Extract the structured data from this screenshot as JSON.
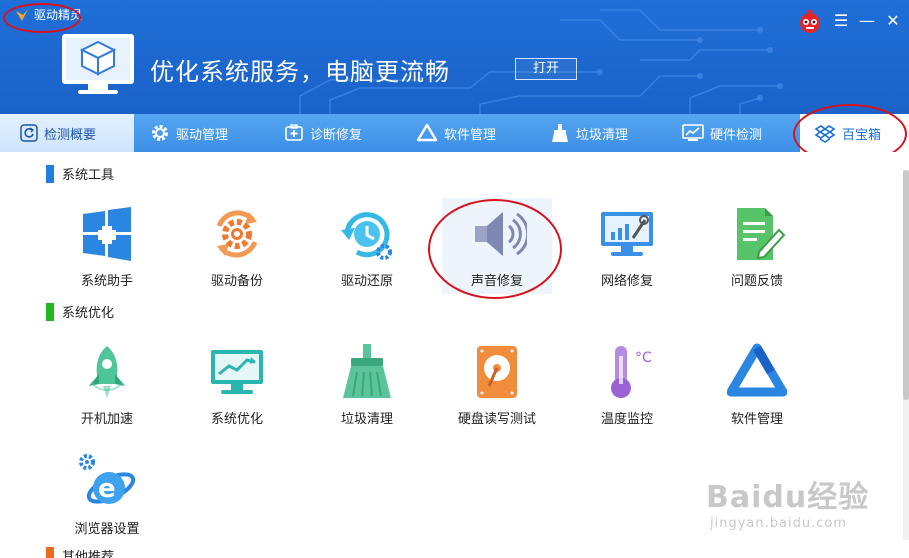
{
  "app": {
    "title": "驱动精灵"
  },
  "banner": {
    "slogan": "优化系统服务，电脑更流畅",
    "open_label": "打开"
  },
  "window": {
    "menu_glyph": "☰",
    "minimize_glyph": "—",
    "close_glyph": "✕"
  },
  "tabs": [
    {
      "label": "检测概要",
      "icon": "refresh-icon"
    },
    {
      "label": "驱动管理",
      "icon": "gear-icon"
    },
    {
      "label": "诊断修复",
      "icon": "medkit-icon"
    },
    {
      "label": "软件管理",
      "icon": "triangle-logo-icon"
    },
    {
      "label": "垃圾清理",
      "icon": "broom-icon"
    },
    {
      "label": "硬件检测",
      "icon": "chart-icon"
    },
    {
      "label": "百宝箱",
      "icon": "dropbox-icon"
    }
  ],
  "sections": [
    {
      "title": "系统工具",
      "color": "#1e7fe0",
      "items": [
        {
          "label": "系统助手",
          "icon": "windows-plus-icon"
        },
        {
          "label": "驱动备份",
          "icon": "gear-backup-icon"
        },
        {
          "label": "驱动还原",
          "icon": "clock-restore-icon"
        },
        {
          "label": "声音修复",
          "icon": "speaker-icon"
        },
        {
          "label": "网络修复",
          "icon": "network-monitor-icon"
        },
        {
          "label": "问题反馈",
          "icon": "feedback-doc-icon"
        }
      ]
    },
    {
      "title": "系统优化",
      "color": "#22b822",
      "items": [
        {
          "label": "开机加速",
          "icon": "rocket-icon"
        },
        {
          "label": "系统优化",
          "icon": "monitor-chart-icon"
        },
        {
          "label": "垃圾清理",
          "icon": "broom-icon"
        },
        {
          "label": "硬盘读写测试",
          "icon": "hard-disk-icon"
        },
        {
          "label": "温度监控",
          "icon": "thermometer-icon"
        },
        {
          "label": "软件管理",
          "icon": "triangle-logo-icon"
        },
        {
          "label": "浏览器设置",
          "icon": "ie-browser-icon"
        }
      ]
    },
    {
      "title": "其他推荐",
      "color": "#ee6a1f"
    }
  ],
  "temperature_unit": "°C",
  "watermark": {
    "brand": "Baidu经验",
    "url": "jingyan.baidu.com"
  }
}
